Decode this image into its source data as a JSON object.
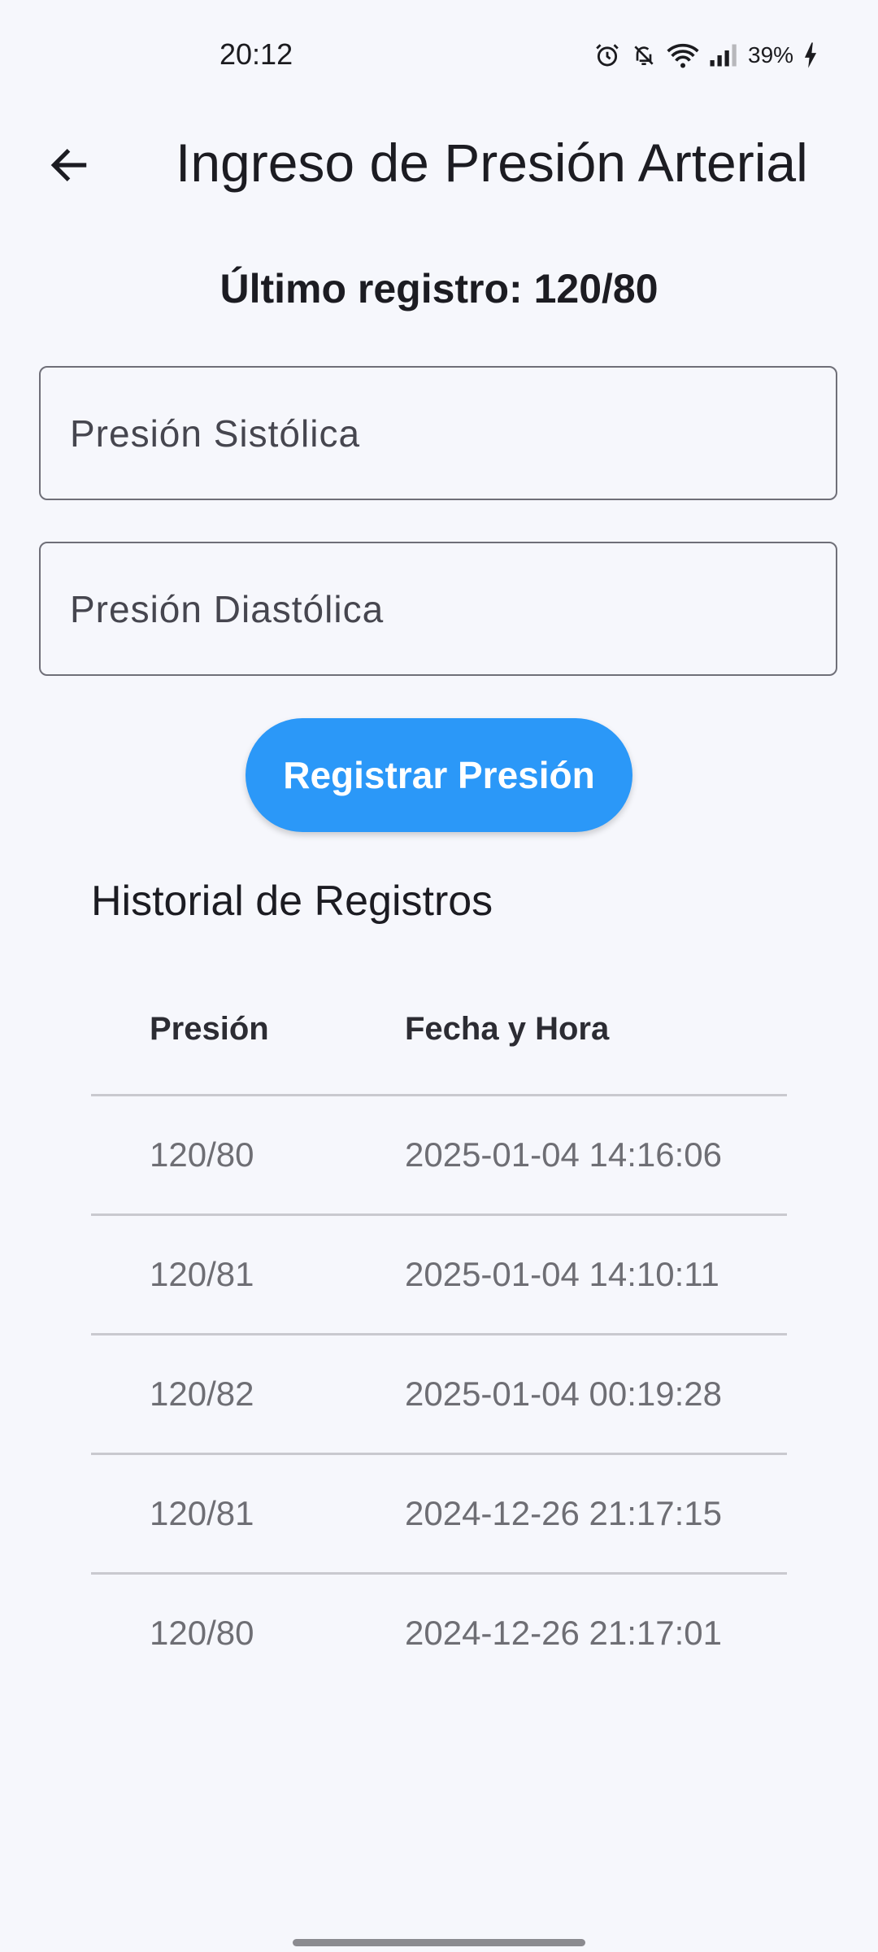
{
  "status_bar": {
    "time": "20:12",
    "battery": "39%",
    "icons": [
      "alarm-icon",
      "bell-off-icon",
      "wifi-icon",
      "signal-icon",
      "charging-icon"
    ]
  },
  "app_bar": {
    "title": "Ingreso de Presión Arterial",
    "back_icon": "arrow-back-icon"
  },
  "last_record": "Último registro: 120/80",
  "form": {
    "systolic_placeholder": "Presión Sistólica",
    "systolic_value": "",
    "diastolic_placeholder": "Presión Diastólica",
    "diastolic_value": "",
    "submit_label": "Registrar Presión"
  },
  "history": {
    "title": "Historial de Registros",
    "columns": [
      "Presión",
      "Fecha y Hora"
    ],
    "rows": [
      [
        "120/80",
        "2025-01-04 14:16:06"
      ],
      [
        "120/81",
        "2025-01-04 14:10:11"
      ],
      [
        "120/82",
        "2025-01-04 00:19:28"
      ],
      [
        "120/81",
        "2024-12-26 21:17:15"
      ],
      [
        "120/80",
        "2024-12-26 21:17:01"
      ]
    ]
  },
  "colors": {
    "background": "#f6f7fc",
    "primary": "#2b98f8",
    "text": "#1c1c22",
    "muted_text": "#6e6e74"
  }
}
